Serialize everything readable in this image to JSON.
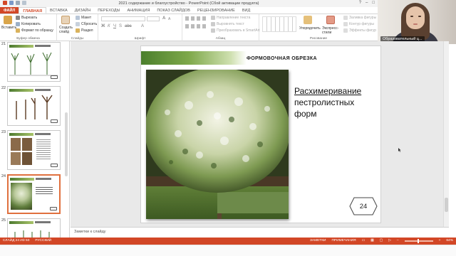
{
  "window": {
    "title": "2021 содержание и благоустройство - PowerPoint (Сбой активации продукта)"
  },
  "tabs": [
    {
      "label": "ФАЙЛ"
    },
    {
      "label": "ГЛАВНАЯ"
    },
    {
      "label": "ВСТАВКА"
    },
    {
      "label": "ДИЗАЙН"
    },
    {
      "label": "ПЕРЕХОДЫ"
    },
    {
      "label": "АНИМАЦИЯ"
    },
    {
      "label": "ПОКАЗ СЛАЙДОВ"
    },
    {
      "label": "РЕЦЕНЗИРОВАНИЕ"
    },
    {
      "label": "ВИД"
    }
  ],
  "ribbon": {
    "clipboard": {
      "paste": "Вставить",
      "cut": "Вырезать",
      "copy": "Копировать",
      "format_painter": "Формат по образцу",
      "label": "Буфер обмена"
    },
    "slides": {
      "new_slide": "Создать слайд",
      "layout": "Макет",
      "reset": "Сбросить",
      "section": "Раздел",
      "label": "Слайды"
    },
    "font": {
      "label": "Шрифт"
    },
    "paragraph": {
      "text_direction": "Направление текста",
      "align_text": "Выровнять текст",
      "smartart": "Преобразовать в SmartArt",
      "label": "Абзац"
    },
    "drawing": {
      "arrange": "Упорядочить",
      "quick_styles": "Экспресс-стили",
      "fill": "Заливка фигуры",
      "outline": "Контур фигуры",
      "effects": "Эффекты фигур",
      "label": "Рисование"
    }
  },
  "webcam": {
    "name": "Образовательный ц..."
  },
  "thumbnails": [
    {
      "number": "21"
    },
    {
      "number": "22"
    },
    {
      "number": "23"
    },
    {
      "number": "24",
      "selected": true
    },
    {
      "number": "25"
    }
  ],
  "slide": {
    "header": "ФОРМОВОЧНАЯ  ОБРЕЗКА",
    "body_line1": "Расхимеривание",
    "body_line2": "пестролистных",
    "body_line3": "форм",
    "number": "24"
  },
  "notes": {
    "placeholder": "Заметки к слайду"
  },
  "status": {
    "slide_info": "СЛАЙД 24 ИЗ 50",
    "language": "РУССКИЙ",
    "notes": "ЗАМЕТКИ",
    "comments": "ПРИМЕЧАНИЯ",
    "zoom": "64%"
  },
  "colors": {
    "accent": "#d24726",
    "header_green": "#4b7f2c"
  }
}
